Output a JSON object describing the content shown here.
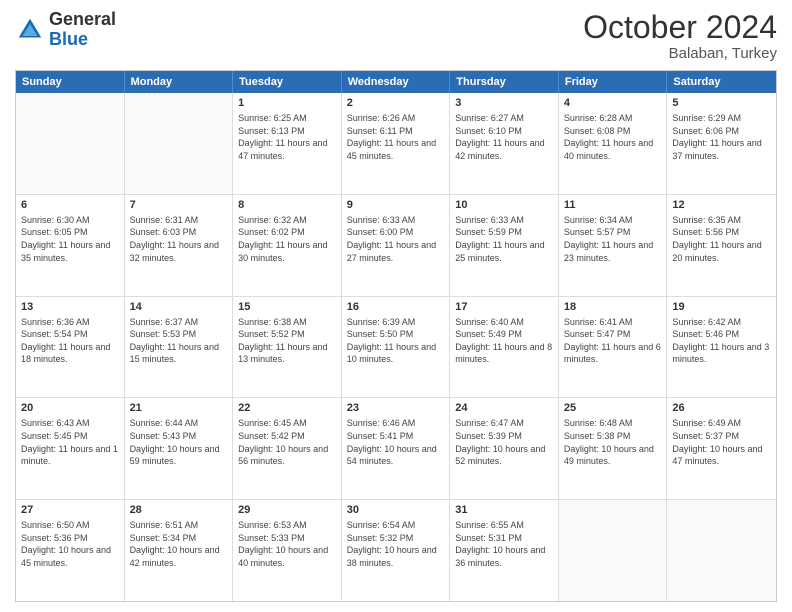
{
  "logo": {
    "general": "General",
    "blue": "Blue"
  },
  "title": "October 2024",
  "subtitle": "Balaban, Turkey",
  "header_days": [
    "Sunday",
    "Monday",
    "Tuesday",
    "Wednesday",
    "Thursday",
    "Friday",
    "Saturday"
  ],
  "rows": [
    [
      {
        "day": "",
        "info": "",
        "empty": true
      },
      {
        "day": "",
        "info": "",
        "empty": true
      },
      {
        "day": "1",
        "info": "Sunrise: 6:25 AM\nSunset: 6:13 PM\nDaylight: 11 hours and 47 minutes."
      },
      {
        "day": "2",
        "info": "Sunrise: 6:26 AM\nSunset: 6:11 PM\nDaylight: 11 hours and 45 minutes."
      },
      {
        "day": "3",
        "info": "Sunrise: 6:27 AM\nSunset: 6:10 PM\nDaylight: 11 hours and 42 minutes."
      },
      {
        "day": "4",
        "info": "Sunrise: 6:28 AM\nSunset: 6:08 PM\nDaylight: 11 hours and 40 minutes."
      },
      {
        "day": "5",
        "info": "Sunrise: 6:29 AM\nSunset: 6:06 PM\nDaylight: 11 hours and 37 minutes."
      }
    ],
    [
      {
        "day": "6",
        "info": "Sunrise: 6:30 AM\nSunset: 6:05 PM\nDaylight: 11 hours and 35 minutes."
      },
      {
        "day": "7",
        "info": "Sunrise: 6:31 AM\nSunset: 6:03 PM\nDaylight: 11 hours and 32 minutes."
      },
      {
        "day": "8",
        "info": "Sunrise: 6:32 AM\nSunset: 6:02 PM\nDaylight: 11 hours and 30 minutes."
      },
      {
        "day": "9",
        "info": "Sunrise: 6:33 AM\nSunset: 6:00 PM\nDaylight: 11 hours and 27 minutes."
      },
      {
        "day": "10",
        "info": "Sunrise: 6:33 AM\nSunset: 5:59 PM\nDaylight: 11 hours and 25 minutes."
      },
      {
        "day": "11",
        "info": "Sunrise: 6:34 AM\nSunset: 5:57 PM\nDaylight: 11 hours and 23 minutes."
      },
      {
        "day": "12",
        "info": "Sunrise: 6:35 AM\nSunset: 5:56 PM\nDaylight: 11 hours and 20 minutes."
      }
    ],
    [
      {
        "day": "13",
        "info": "Sunrise: 6:36 AM\nSunset: 5:54 PM\nDaylight: 11 hours and 18 minutes."
      },
      {
        "day": "14",
        "info": "Sunrise: 6:37 AM\nSunset: 5:53 PM\nDaylight: 11 hours and 15 minutes."
      },
      {
        "day": "15",
        "info": "Sunrise: 6:38 AM\nSunset: 5:52 PM\nDaylight: 11 hours and 13 minutes."
      },
      {
        "day": "16",
        "info": "Sunrise: 6:39 AM\nSunset: 5:50 PM\nDaylight: 11 hours and 10 minutes."
      },
      {
        "day": "17",
        "info": "Sunrise: 6:40 AM\nSunset: 5:49 PM\nDaylight: 11 hours and 8 minutes."
      },
      {
        "day": "18",
        "info": "Sunrise: 6:41 AM\nSunset: 5:47 PM\nDaylight: 11 hours and 6 minutes."
      },
      {
        "day": "19",
        "info": "Sunrise: 6:42 AM\nSunset: 5:46 PM\nDaylight: 11 hours and 3 minutes."
      }
    ],
    [
      {
        "day": "20",
        "info": "Sunrise: 6:43 AM\nSunset: 5:45 PM\nDaylight: 11 hours and 1 minute."
      },
      {
        "day": "21",
        "info": "Sunrise: 6:44 AM\nSunset: 5:43 PM\nDaylight: 10 hours and 59 minutes."
      },
      {
        "day": "22",
        "info": "Sunrise: 6:45 AM\nSunset: 5:42 PM\nDaylight: 10 hours and 56 minutes."
      },
      {
        "day": "23",
        "info": "Sunrise: 6:46 AM\nSunset: 5:41 PM\nDaylight: 10 hours and 54 minutes."
      },
      {
        "day": "24",
        "info": "Sunrise: 6:47 AM\nSunset: 5:39 PM\nDaylight: 10 hours and 52 minutes."
      },
      {
        "day": "25",
        "info": "Sunrise: 6:48 AM\nSunset: 5:38 PM\nDaylight: 10 hours and 49 minutes."
      },
      {
        "day": "26",
        "info": "Sunrise: 6:49 AM\nSunset: 5:37 PM\nDaylight: 10 hours and 47 minutes."
      }
    ],
    [
      {
        "day": "27",
        "info": "Sunrise: 6:50 AM\nSunset: 5:36 PM\nDaylight: 10 hours and 45 minutes."
      },
      {
        "day": "28",
        "info": "Sunrise: 6:51 AM\nSunset: 5:34 PM\nDaylight: 10 hours and 42 minutes."
      },
      {
        "day": "29",
        "info": "Sunrise: 6:53 AM\nSunset: 5:33 PM\nDaylight: 10 hours and 40 minutes."
      },
      {
        "day": "30",
        "info": "Sunrise: 6:54 AM\nSunset: 5:32 PM\nDaylight: 10 hours and 38 minutes."
      },
      {
        "day": "31",
        "info": "Sunrise: 6:55 AM\nSunset: 5:31 PM\nDaylight: 10 hours and 36 minutes."
      },
      {
        "day": "",
        "info": "",
        "empty": true
      },
      {
        "day": "",
        "info": "",
        "empty": true
      }
    ]
  ]
}
